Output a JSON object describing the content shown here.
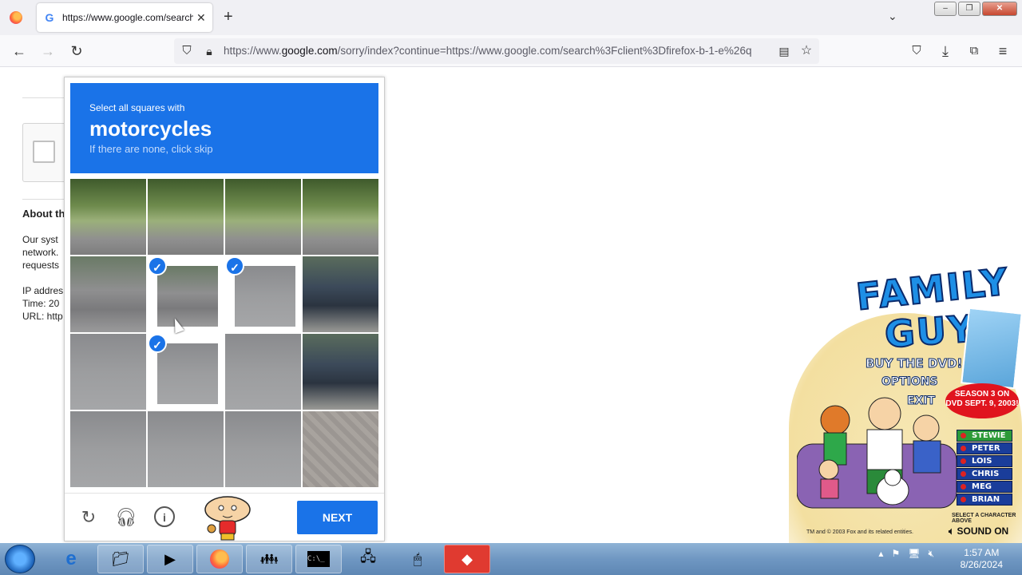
{
  "browser": {
    "tab_title": "https://www.google.com/search",
    "tab_close": "✕",
    "new_tab": "+",
    "url_prefix": "https://www.",
    "url_domain": "google.com",
    "url_rest": "/sorry/index?continue=https://www.google.com/search%3Fclient%3Dfirefox-b-1-e%26q",
    "window_buttons": [
      "–",
      "❐",
      "✕"
    ]
  },
  "background_page": {
    "heading": "About th",
    "paragraph_lines": [
      "Our syst",
      "network.",
      "requests"
    ],
    "meta_lines": [
      "IP addres",
      "Time: 20",
      "URL: http"
    ]
  },
  "captcha": {
    "instruction": "Select all squares with",
    "target": "motorcycles",
    "hint": "If there are none, click skip",
    "next_label": "NEXT",
    "tiles": [
      {
        "row": 0,
        "col": 0,
        "scene": "tree",
        "selected": false
      },
      {
        "row": 0,
        "col": 1,
        "scene": "tree",
        "selected": false
      },
      {
        "row": 0,
        "col": 2,
        "scene": "tree",
        "selected": false
      },
      {
        "row": 0,
        "col": 3,
        "scene": "tree",
        "selected": false
      },
      {
        "row": 1,
        "col": 0,
        "scene": "bike",
        "selected": false
      },
      {
        "row": 1,
        "col": 1,
        "scene": "bike",
        "selected": true
      },
      {
        "row": 1,
        "col": 2,
        "scene": "road",
        "selected": true
      },
      {
        "row": 1,
        "col": 3,
        "scene": "carside",
        "selected": false
      },
      {
        "row": 2,
        "col": 0,
        "scene": "road",
        "selected": false
      },
      {
        "row": 2,
        "col": 1,
        "scene": "road",
        "selected": true
      },
      {
        "row": 2,
        "col": 2,
        "scene": "road",
        "selected": false
      },
      {
        "row": 2,
        "col": 3,
        "scene": "carside",
        "selected": false
      },
      {
        "row": 3,
        "col": 0,
        "scene": "road",
        "selected": false
      },
      {
        "row": 3,
        "col": 1,
        "scene": "road",
        "selected": false
      },
      {
        "row": 3,
        "col": 2,
        "scene": "road",
        "selected": false
      },
      {
        "row": 3,
        "col": 3,
        "scene": "paving",
        "selected": false
      }
    ],
    "footer_icons": [
      "reload-icon",
      "audio-icon",
      "info-icon"
    ]
  },
  "ad": {
    "title_line1": "FAMILY",
    "title_line2": "GUY",
    "buy": "BUY THE DVD!",
    "options": "OPTIONS",
    "exit": "EXIT",
    "season": "SEASON 3 ON DVD SEPT. 9, 2003!",
    "characters": [
      "STEWIE",
      "PETER",
      "LOIS",
      "CHRIS",
      "MEG",
      "BRIAN"
    ],
    "select_prompt": "SELECT A CHARACTER ABOVE",
    "copyright": "TM and © 2003 Fox and its related entities.",
    "sound": "SOUND ON"
  },
  "taskbar": {
    "time": "1:57 AM",
    "date": "8/26/2024"
  },
  "colors": {
    "captcha_blue": "#1a73e8",
    "taskbar": "#6f97c2"
  }
}
